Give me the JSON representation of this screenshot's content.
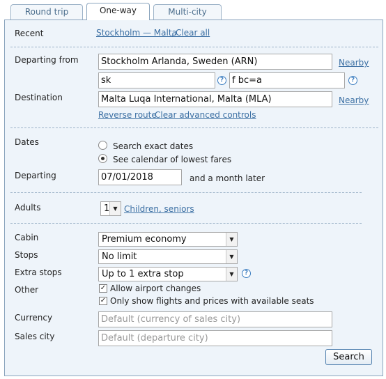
{
  "tabs": [
    {
      "label": "Round trip",
      "active": false
    },
    {
      "label": "One-way",
      "active": true
    },
    {
      "label": "Multi-city",
      "active": false
    }
  ],
  "recent": {
    "label": "Recent",
    "route_link": "Stockholm — Malta",
    "separator": ",",
    "clear_link": "Clear all"
  },
  "departing": {
    "label": "Departing from",
    "value": "Stockholm Arlanda, Sweden (ARN)",
    "nearby": "Nearby",
    "routing_code": "sk",
    "extension_code": "f bc=a"
  },
  "destination": {
    "label": "Destination",
    "value": "Malta Luqa International, Malta (MLA)",
    "nearby": "Nearby",
    "reverse_link": "Reverse route",
    "clear_advanced_link": "Clear advanced controls"
  },
  "dates": {
    "label": "Dates",
    "option_exact": "Search exact dates",
    "option_calendar": "See calendar of lowest fares",
    "selected": "calendar",
    "departing_label": "Departing",
    "departing_value": "07/01/2018",
    "range_text": "and a month later"
  },
  "adults": {
    "label": "Adults",
    "value": "1",
    "children_link": "Children, seniors"
  },
  "cabin": {
    "label": "Cabin",
    "value": "Premium economy"
  },
  "stops": {
    "label": "Stops",
    "value": "No limit"
  },
  "extra_stops": {
    "label": "Extra stops",
    "value": "Up to 1 extra stop"
  },
  "other": {
    "label": "Other",
    "allow_airport_changes": "Allow airport changes",
    "allow_checked": true,
    "only_available": "Only show flights and prices with available seats",
    "only_checked": true
  },
  "currency": {
    "label": "Currency",
    "placeholder": "Default (currency of sales city)"
  },
  "sales_city": {
    "label": "Sales city",
    "placeholder": "Default (departure city)"
  },
  "search_button": "Search",
  "icons": {
    "help": "?",
    "dropdown": "▼",
    "check": "✓"
  }
}
